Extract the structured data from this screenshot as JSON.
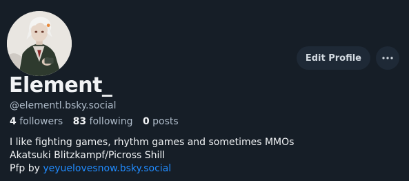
{
  "profile": {
    "display_name": "Element_",
    "handle": "@elementl.bsky.social",
    "followers_count": "4",
    "followers_label": "followers",
    "following_count": "83",
    "following_label": "following",
    "posts_count": "0",
    "posts_label": "posts",
    "bio_line1": "I like fighting games, rhythm games and sometimes MMOs",
    "bio_line2": "Akatsuki Blitzkampf/Picross Shill",
    "bio_line3_prefix": "Pfp by ",
    "bio_link": "yeyuelovesnow.bsky.social",
    "avatar_icon": "avatar-illustration"
  },
  "actions": {
    "edit_profile_label": "Edit Profile",
    "more_icon": "ellipsis-icon"
  },
  "colors": {
    "background": "#161e27",
    "button_bg": "#1e2936",
    "link": "#208bfe",
    "text": "#f1f3f5",
    "muted_text": "#aebbc9"
  }
}
